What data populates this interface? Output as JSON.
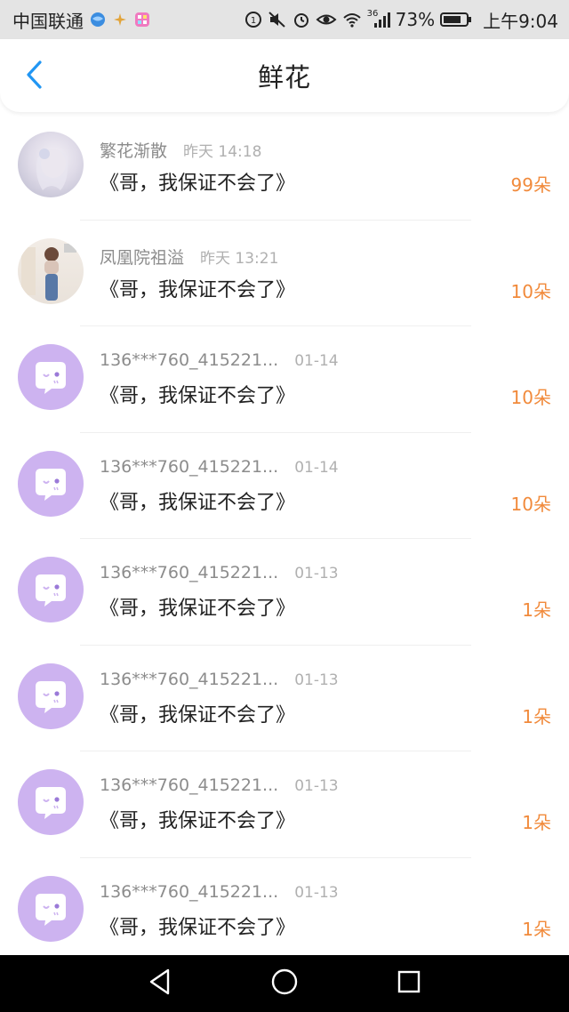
{
  "status_bar": {
    "carrier": "中国联通",
    "battery": "73%",
    "time": "上午9:04",
    "network": "36"
  },
  "header": {
    "title": "鲜花",
    "back_icon": "chevron-left-icon"
  },
  "colors": {
    "accent": "#2196f3",
    "count": "#f18a3b",
    "avatar_default": "#cdb3f0"
  },
  "messages": [
    {
      "sender": "繁花渐散",
      "time": "昨天 14:18",
      "text": "《哥，我保证不会了》",
      "count": "99朵",
      "avatar": "photo"
    },
    {
      "sender": "凤凰院祖溢",
      "time": "昨天 13:21",
      "text": "《哥，我保证不会了》",
      "count": "10朵",
      "avatar": "photo"
    },
    {
      "sender": "136***760_415221...",
      "time": "01-14",
      "text": "《哥，我保证不会了》",
      "count": "10朵",
      "avatar": "default"
    },
    {
      "sender": "136***760_415221...",
      "time": "01-14",
      "text": "《哥，我保证不会了》",
      "count": "10朵",
      "avatar": "default"
    },
    {
      "sender": "136***760_415221...",
      "time": "01-13",
      "text": "《哥，我保证不会了》",
      "count": "1朵",
      "avatar": "default"
    },
    {
      "sender": "136***760_415221...",
      "time": "01-13",
      "text": "《哥，我保证不会了》",
      "count": "1朵",
      "avatar": "default"
    },
    {
      "sender": "136***760_415221...",
      "time": "01-13",
      "text": "《哥，我保证不会了》",
      "count": "1朵",
      "avatar": "default"
    },
    {
      "sender": "136***760_415221...",
      "time": "01-13",
      "text": "《哥，我保证不会了》",
      "count": "1朵",
      "avatar": "default"
    }
  ],
  "nav_bar": {
    "icons": [
      "back-triangle-icon",
      "home-circle-icon",
      "recents-square-icon"
    ]
  }
}
